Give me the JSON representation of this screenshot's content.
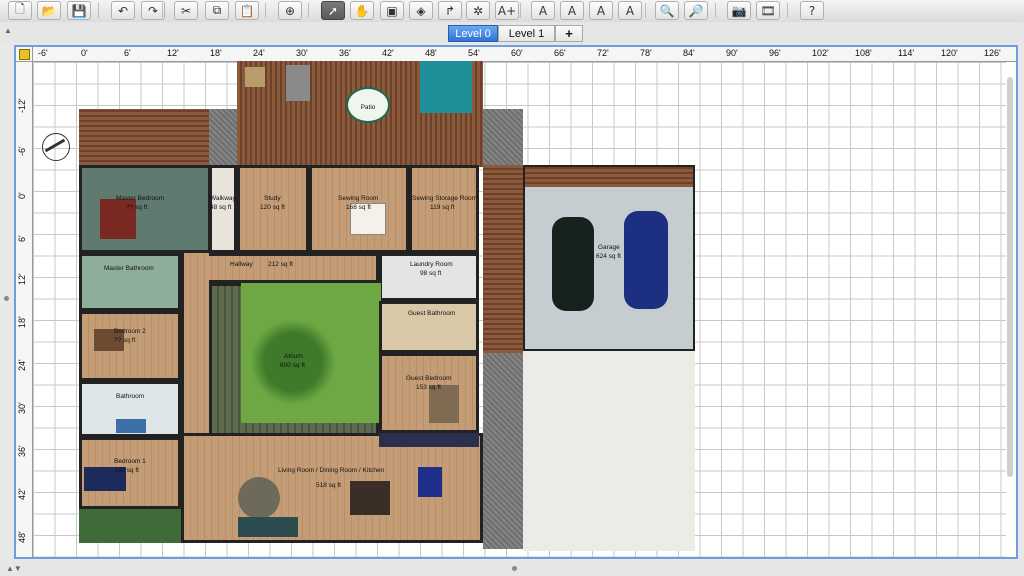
{
  "toolbar": {
    "buttons": [
      {
        "name": "new-home-button",
        "glyph": "🗋"
      },
      {
        "name": "open-button",
        "glyph": "📂"
      },
      {
        "name": "save-button",
        "glyph": "💾"
      },
      {
        "name": "undo-button",
        "glyph": "↶"
      },
      {
        "name": "redo-button",
        "glyph": "↷"
      },
      {
        "name": "cut-button",
        "glyph": "✂"
      },
      {
        "name": "copy-button",
        "glyph": "⧉"
      },
      {
        "name": "paste-button",
        "glyph": "📋"
      },
      {
        "name": "add-furniture-button",
        "glyph": "⊕"
      },
      {
        "name": "select-mode-button",
        "glyph": "➚"
      },
      {
        "name": "pan-mode-button",
        "glyph": "✋"
      },
      {
        "name": "create-walls-button",
        "glyph": "▣"
      },
      {
        "name": "create-rooms-button",
        "glyph": "◈"
      },
      {
        "name": "create-polylines-button",
        "glyph": "↱"
      },
      {
        "name": "create-dimensions-button",
        "glyph": "✲"
      },
      {
        "name": "add-text-button",
        "glyph": "A+"
      },
      {
        "name": "increase-text-button",
        "glyph": "A"
      },
      {
        "name": "decrease-text-button",
        "glyph": "A"
      },
      {
        "name": "bold-text-button",
        "glyph": "A"
      },
      {
        "name": "italic-text-button",
        "glyph": "A"
      },
      {
        "name": "zoom-in-button",
        "glyph": "🔍"
      },
      {
        "name": "zoom-out-button",
        "glyph": "🔎"
      },
      {
        "name": "create-photo-button",
        "glyph": "📷"
      },
      {
        "name": "create-video-button",
        "glyph": "🎞"
      },
      {
        "name": "help-button",
        "glyph": "?"
      }
    ]
  },
  "levels": {
    "tabs": [
      "Level 0",
      "Level 1"
    ],
    "add_label": "+",
    "active": "Level 0"
  },
  "ruler": {
    "top": [
      "-6'",
      "0'",
      "6'",
      "12'",
      "18'",
      "24'",
      "30'",
      "36'",
      "42'",
      "48'",
      "54'",
      "60'",
      "66'",
      "72'",
      "78'",
      "84'",
      "90'",
      "96'",
      "102'",
      "108'",
      "114'",
      "120'",
      "126'"
    ],
    "left": [
      "-12'",
      "-6'",
      "0'",
      "6'",
      "12'",
      "18'",
      "24'",
      "30'",
      "36'",
      "42'",
      "48'"
    ]
  },
  "rooms": {
    "patio": "Patio",
    "master_bedroom": "Master Bedroom",
    "master_bedroom_area": "?? sq ft",
    "walkway": "Walkway",
    "walkway_area": "48 sq ft",
    "study": "Study",
    "study_area": "120 sq ft",
    "sewing_room": "Sewing Room",
    "sewing_room_area": "168 sq ft",
    "sewing_storage": "Sewing Storage Room",
    "sewing_storage_area": "119 sq ft",
    "garage": "Garage",
    "garage_area": "624 sq ft",
    "master_bathroom": "Master Bathroom",
    "hallway": "Hallway",
    "hallway_area": "212 sq ft",
    "laundry": "Laundry Room",
    "laundry_area": "98 sq ft",
    "bedroom2": "Bedroom 2",
    "bedroom2_area": "?? sq ft",
    "atrium": "Atrium",
    "atrium_area": "600 sq ft",
    "guest_bathroom": "Guest Bathroom",
    "guest_bedroom": "Guest Bedroom",
    "guest_bedroom_area": "153 sq ft",
    "bathroom": "Bathroom",
    "bedroom1": "Bedroom 1",
    "bedroom1_area": "140 sq ft",
    "living": "Living Room / Dining Room / Kitchen",
    "living_area": "518 sq ft"
  }
}
